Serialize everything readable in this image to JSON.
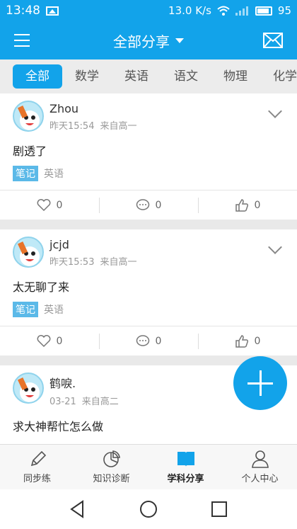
{
  "status": {
    "time": "13:48",
    "speed": "13.0 K/s",
    "battery": "95"
  },
  "appbar": {
    "title": "全部分享"
  },
  "tabs": [
    "全部",
    "数学",
    "英语",
    "语文",
    "物理",
    "化学"
  ],
  "posts": [
    {
      "author": "Zhou",
      "time": "昨天15:54",
      "source": "来自高一",
      "content": "剧透了",
      "tag": "笔记",
      "subject": "英语",
      "likes": "0",
      "comments": "0",
      "thumbs": "0"
    },
    {
      "author": "jcjd",
      "time": "昨天15:53",
      "source": "来自高一",
      "content": "太无聊了来",
      "tag": "笔记",
      "subject": "英语",
      "likes": "0",
      "comments": "0",
      "thumbs": "0"
    },
    {
      "author": "鹤唳.",
      "time": "03-21",
      "source": "来自高二",
      "content": "求大神帮忙怎么做"
    }
  ],
  "bottomnav": [
    "同步练",
    "知识诊断",
    "学科分享",
    "个人中心"
  ],
  "colors": {
    "primary": "#12a3ea",
    "tag": "#5bb9e8"
  }
}
